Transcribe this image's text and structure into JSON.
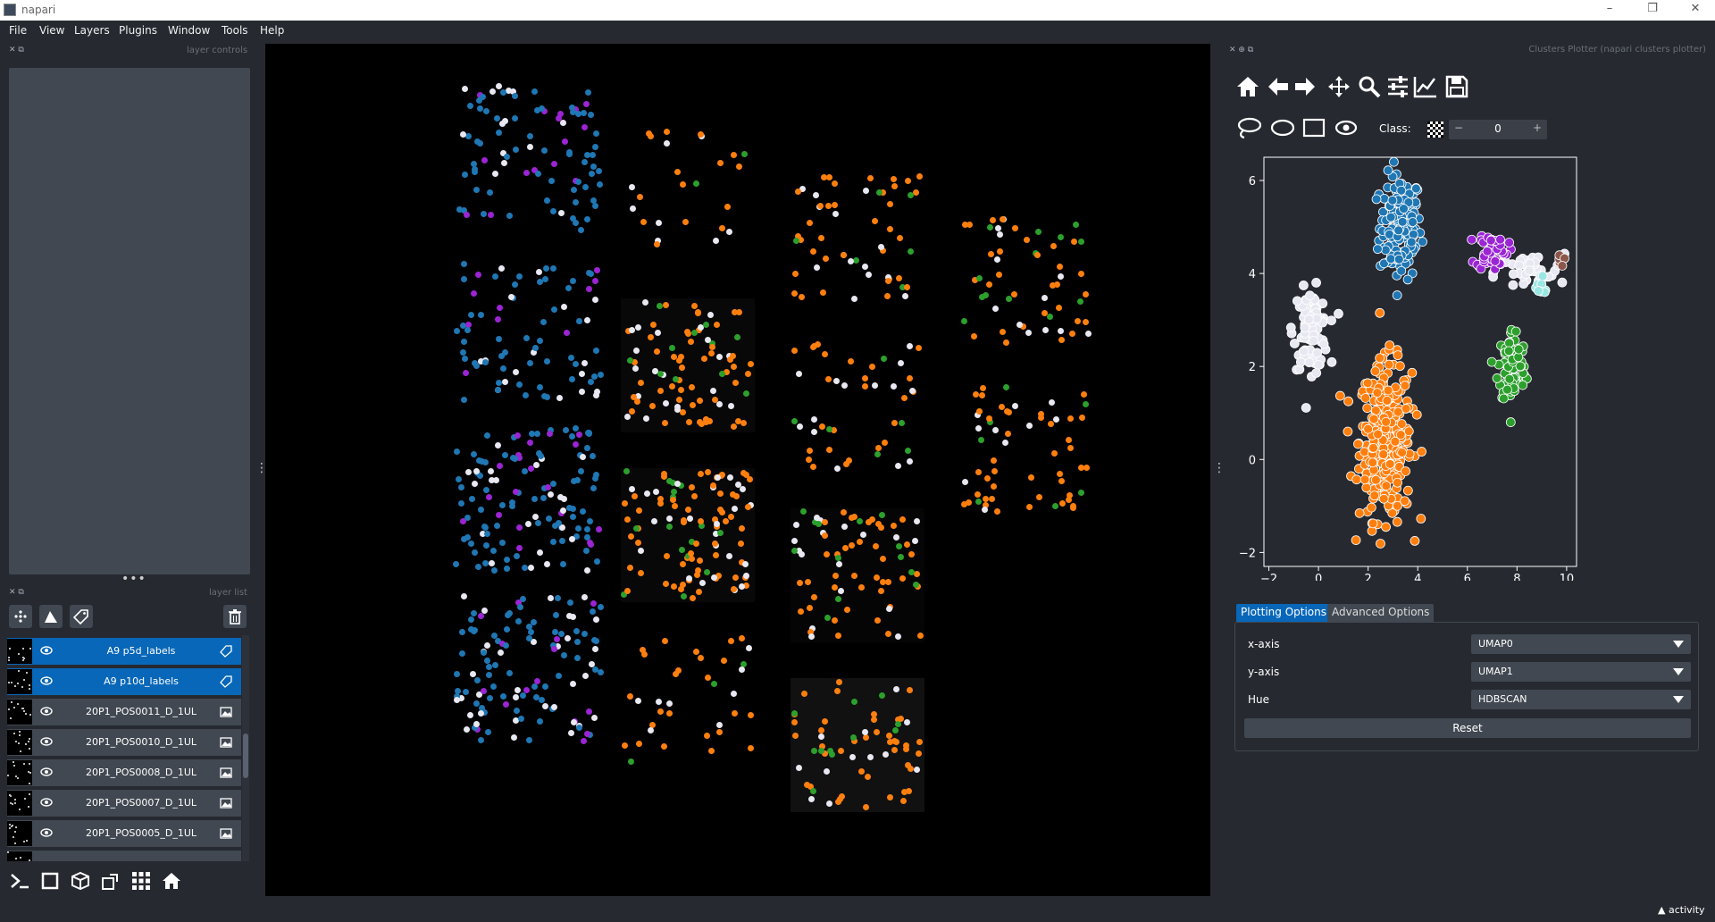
{
  "window": {
    "title": "napari",
    "minimize": "–",
    "maximize": "❐",
    "close": "✕"
  },
  "menu": [
    "File",
    "View",
    "Layers",
    "Plugins",
    "Window",
    "Tools",
    "Help"
  ],
  "left_dock": {
    "layer_controls_title": "layer controls",
    "layer_list_title": "layer list",
    "splitter": "•••"
  },
  "layers": [
    {
      "name": "A9 p5d_labels",
      "type": "labels",
      "selected": true
    },
    {
      "name": "A9 p10d_labels",
      "type": "labels",
      "selected": true
    },
    {
      "name": "20P1_POS0011_D_1UL",
      "type": "image",
      "selected": false
    },
    {
      "name": "20P1_POS0010_D_1UL",
      "type": "image",
      "selected": false
    },
    {
      "name": "20P1_POS0008_D_1UL",
      "type": "image",
      "selected": false
    },
    {
      "name": "20P1_POS0007_D_1UL",
      "type": "image",
      "selected": false
    },
    {
      "name": "20P1_POS0005_D_1UL",
      "type": "image",
      "selected": false
    }
  ],
  "right_dock": {
    "title": "Clusters Plotter (napari clusters plotter)",
    "class_label": "Class:",
    "class_value": "0",
    "tabs": [
      "Plotting Options",
      "Advanced Options"
    ],
    "options": [
      {
        "label": "x-axis",
        "value": "UMAP0"
      },
      {
        "label": "y-axis",
        "value": "UMAP1"
      },
      {
        "label": "Hue",
        "value": "HDBSCAN"
      }
    ],
    "reset_label": "Reset"
  },
  "status": {
    "activity": "activity"
  },
  "colors": {
    "bg": "#262930",
    "panel": "#414851",
    "selected": "#0867b8",
    "plot_bg": "#262930"
  },
  "chart_data": {
    "type": "scatter",
    "title": "",
    "xlabel": "",
    "ylabel": "",
    "xlim": [
      -2.2,
      10.4
    ],
    "ylim": [
      -2.3,
      6.5
    ],
    "xticks": [
      -2,
      0,
      2,
      4,
      6,
      8,
      10
    ],
    "yticks": [
      -2,
      0,
      2,
      4,
      6
    ],
    "series": [
      {
        "color": "#1f77b4",
        "cx": 3.3,
        "cy": 5.0,
        "sx": 0.6,
        "sy": 0.8,
        "n": 160
      },
      {
        "color": "#ff7f0e",
        "cx": 2.7,
        "cy": 0.4,
        "sx": 0.75,
        "sy": 1.2,
        "n": 320
      },
      {
        "color": "#e8e8f2",
        "cx": -0.3,
        "cy": 2.8,
        "sx": 0.5,
        "sy": 0.6,
        "n": 90
      },
      {
        "color": "#e8e8f2",
        "cx": 8.5,
        "cy": 4.0,
        "sx": 1.0,
        "sy": 0.3,
        "n": 40
      },
      {
        "color": "#2ca02c",
        "cx": 7.8,
        "cy": 2.0,
        "sx": 0.4,
        "sy": 0.6,
        "n": 90
      },
      {
        "color": "#9b24d4",
        "cx": 7.0,
        "cy": 4.5,
        "sx": 0.45,
        "sy": 0.3,
        "n": 45
      },
      {
        "color": "#9ae6e2",
        "cx": 8.9,
        "cy": 3.7,
        "sx": 0.3,
        "sy": 0.15,
        "n": 10
      },
      {
        "color": "#8c564b",
        "cx": 9.7,
        "cy": 4.3,
        "sx": 0.15,
        "sy": 0.1,
        "n": 6
      }
    ]
  }
}
